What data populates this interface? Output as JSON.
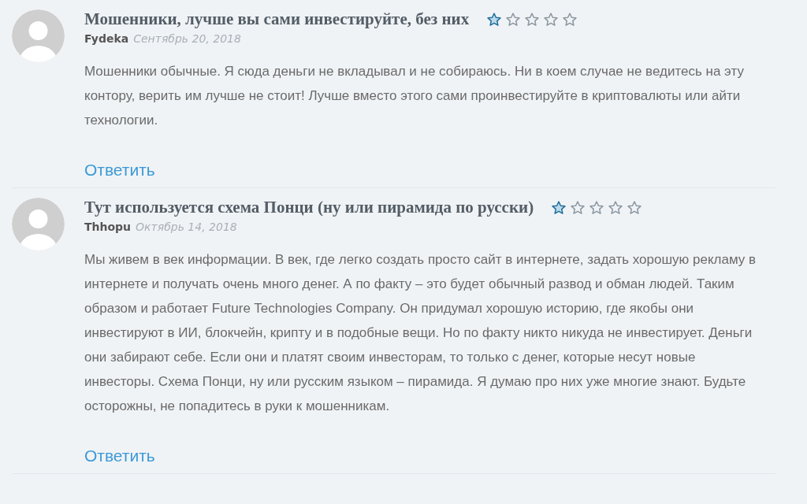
{
  "comments": [
    {
      "title": "Мошенники, лучше вы сами инвестируйте, без них",
      "stars": 1,
      "author": "Fydeka",
      "date": "Сентябрь 20, 2018",
      "text": "Мошенники обычные. Я сюда деньги не вкладывал и не собираюсь. Ни в коем случае не ведитесь на эту контору, верить им лучше не стоит! Лучше вместо этого сами проинвестируйте в криптовалюты или айти технологии.",
      "reply": "Ответить"
    },
    {
      "title": "Тут используется схема Понци (ну или пирамида по русски)",
      "stars": 1,
      "author": "Thhopu",
      "date": "Октябрь 14, 2018",
      "text": "Мы живем в век информации. В век, где легко создать просто сайт в интернете, задать хорошую рекламу в интернете и получать очень много денег. А по факту – это будет обычный развод и обман людей. Таким образом и работает Future Technologies Company. Он придумал хорошую историю, где якобы они инвестируют в ИИ, блокчейн, крипту и в подобные вещи. Но по факту никто никуда не инвестирует. Деньги они забирают себе. Если они и платят своим инвесторам, то только с денег, которые несут новые инвесторы. Схема Понци, ну или русским языком – пирамида. Я думаю про них уже многие знают. Будьте осторожны, не попадитесь в руки к мошенникам.",
      "reply": "Ответить"
    }
  ]
}
